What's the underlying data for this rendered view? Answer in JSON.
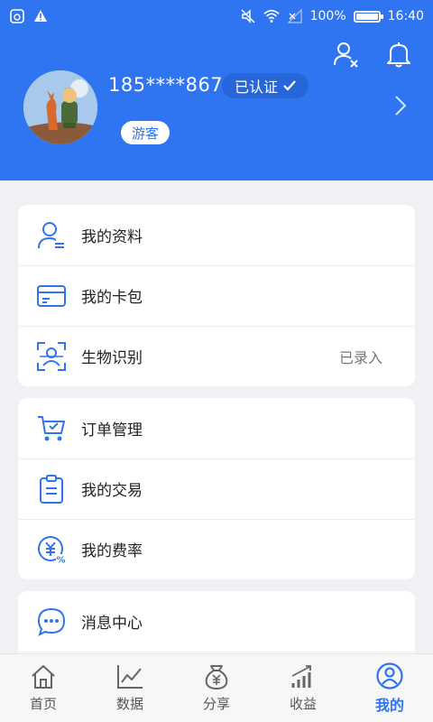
{
  "status_bar": {
    "battery": "100%",
    "time": "16:40"
  },
  "profile": {
    "phone": "185****8676",
    "verified_label": "已认证",
    "guest_label": "游客"
  },
  "menu_group_1": [
    {
      "label": "我的资料",
      "value": ""
    },
    {
      "label": "我的卡包",
      "value": ""
    },
    {
      "label": "生物识别",
      "value": "已录入"
    }
  ],
  "menu_group_2": [
    {
      "label": "订单管理"
    },
    {
      "label": "我的交易"
    },
    {
      "label": "我的费率"
    }
  ],
  "menu_group_3": [
    {
      "label": "消息中心"
    }
  ],
  "tabs": [
    {
      "label": "首页"
    },
    {
      "label": "数据"
    },
    {
      "label": "分享"
    },
    {
      "label": "收益"
    },
    {
      "label": "我的"
    }
  ],
  "colors": {
    "primary": "#2f74f1",
    "background": "#eff1f5"
  }
}
